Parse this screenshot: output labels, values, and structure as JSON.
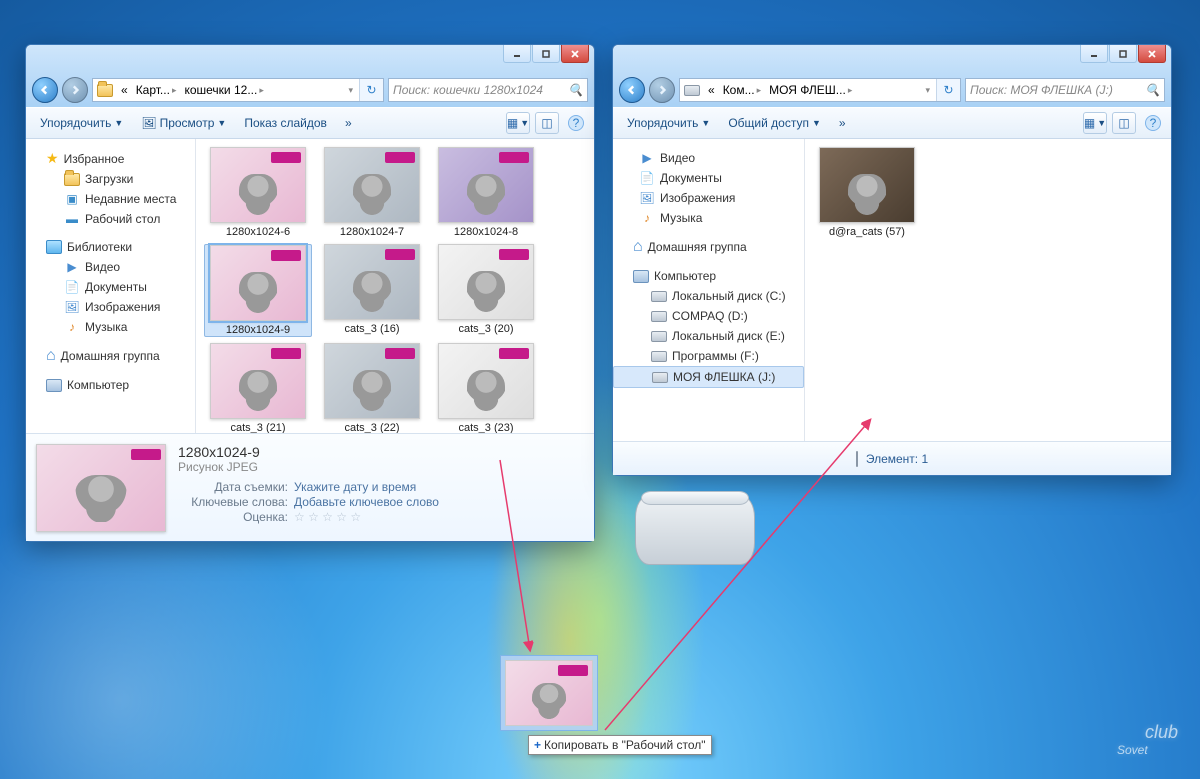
{
  "win1": {
    "crumb_prefix": "«",
    "crumbs": [
      "Карт...",
      "кошечки 12..."
    ],
    "search_placeholder": "Поиск: кошечки 1280x1024",
    "toolbar": {
      "organize": "Упорядочить",
      "preview": "Просмотр",
      "slideshow": "Показ слайдов",
      "more": "»"
    },
    "tree": {
      "favorites": {
        "label": "Избранное",
        "items": [
          "Загрузки",
          "Недавние места",
          "Рабочий стол"
        ]
      },
      "libraries": {
        "label": "Библиотеки",
        "items": [
          "Видео",
          "Документы",
          "Изображения",
          "Музыка"
        ]
      },
      "homegroup": "Домашняя группа",
      "computer": "Компьютер"
    },
    "files": [
      "1280x1024-6",
      "1280x1024-7",
      "1280x1024-8",
      "1280x1024-9",
      "cats_3 (16)",
      "cats_3 (20)",
      "cats_3 (21)",
      "cats_3 (22)",
      "cats_3 (23)"
    ],
    "selected": "1280x1024-9",
    "details": {
      "title": "1280x1024-9",
      "type": "Рисунок JPEG",
      "date_label": "Дата съемки:",
      "date_val": "Укажите дату и время",
      "tags_label": "Ключевые слова:",
      "tags_val": "Добавьте ключевое слово",
      "rating_label": "Оценка:"
    }
  },
  "win2": {
    "crumb_prefix": "«",
    "crumbs": [
      "Ком...",
      "МОЯ ФЛЕШ..."
    ],
    "search_placeholder": "Поиск: МОЯ ФЛЕШКА (J:)",
    "toolbar": {
      "organize": "Упорядочить",
      "share": "Общий доступ",
      "more": "»"
    },
    "tree": {
      "libraries": {
        "items": [
          "Видео",
          "Документы",
          "Изображения",
          "Музыка"
        ]
      },
      "homegroup": "Домашняя группа",
      "computer": {
        "label": "Компьютер",
        "drives": [
          "Локальный диск (C:)",
          "COMPAQ (D:)",
          "Локальный диск (E:)",
          "Программы  (F:)",
          "МОЯ ФЛЕШКА (J:)"
        ]
      }
    },
    "files": [
      "d@ra_cats (57)"
    ],
    "status": "Элемент: 1"
  },
  "drag_tip": "Копировать в \"Рабочий стол\"",
  "watermark": {
    "top": "club",
    "bottom": "Sovet"
  }
}
